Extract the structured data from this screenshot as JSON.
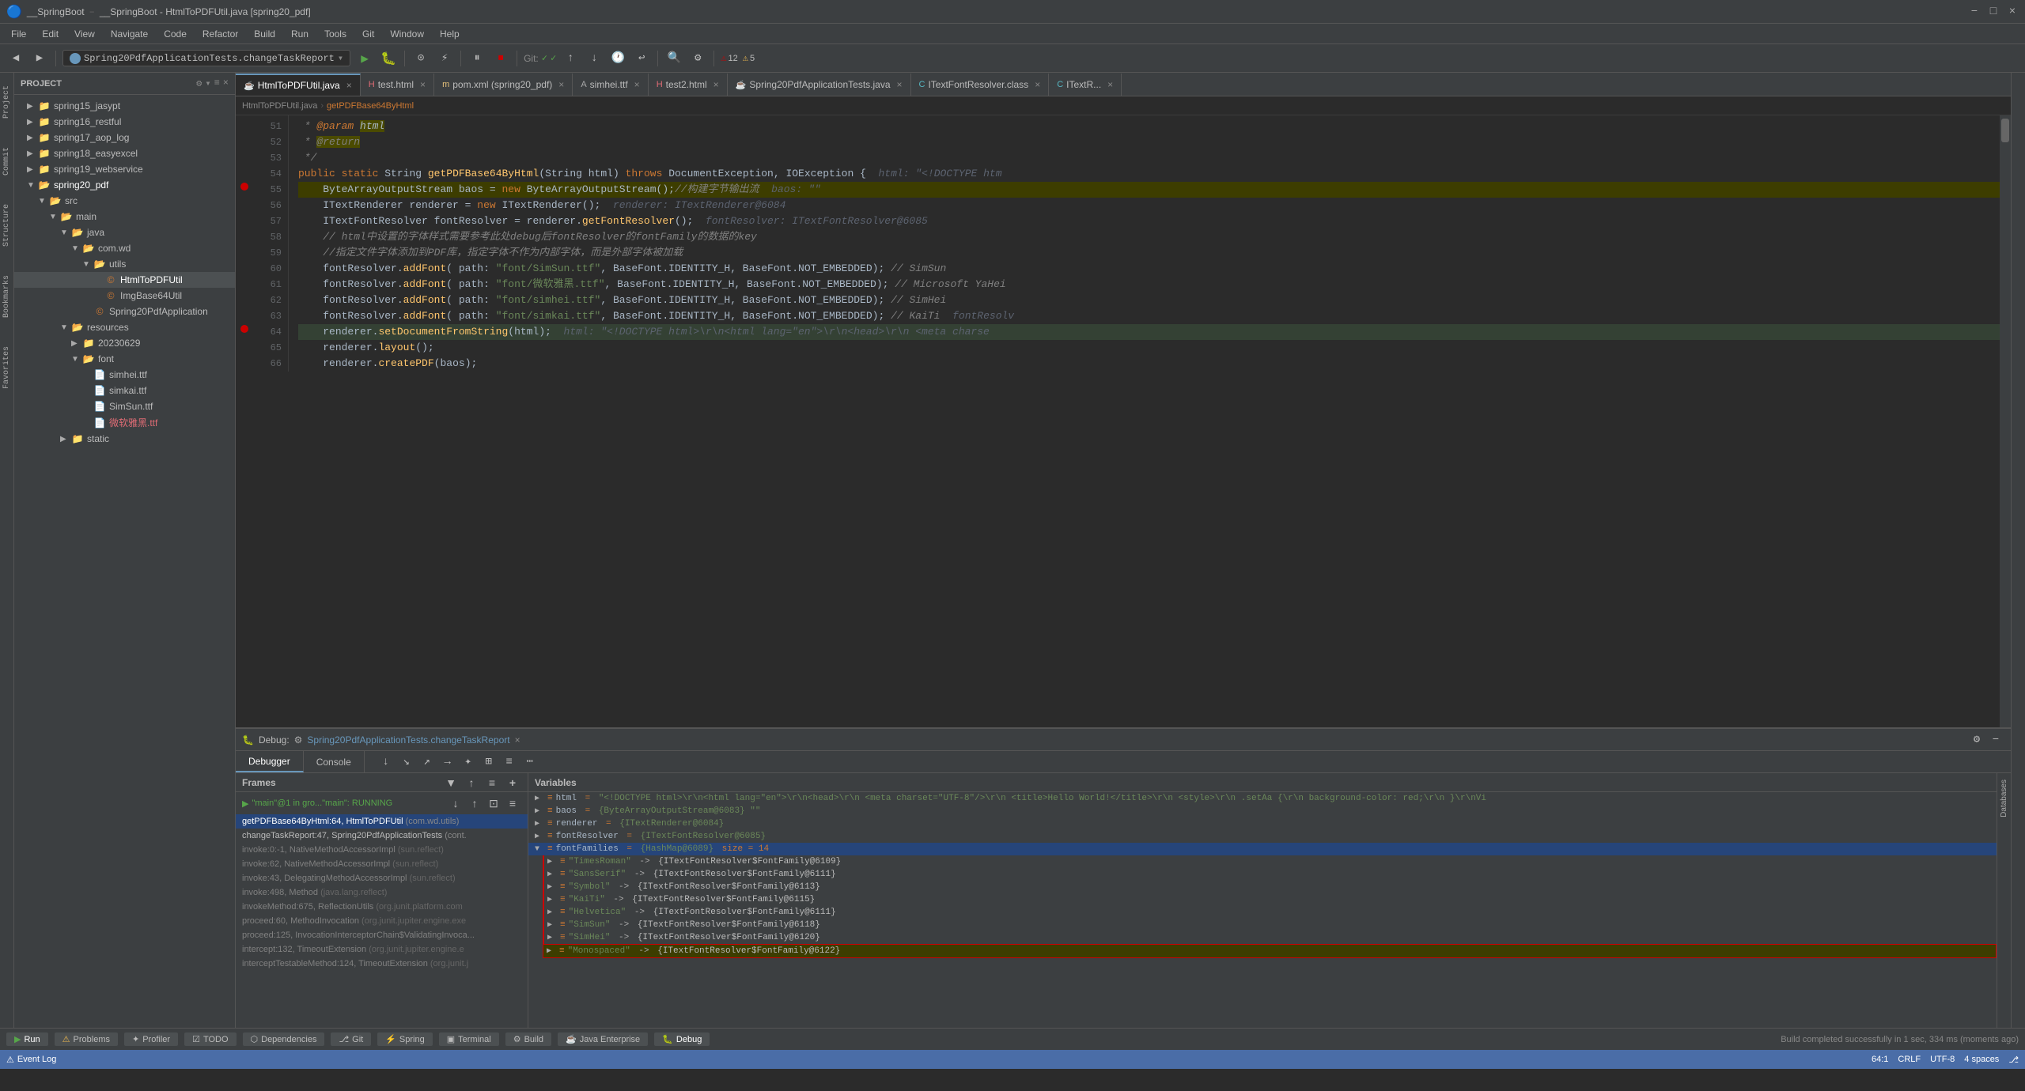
{
  "titleBar": {
    "title": "__SpringBoot - HtmlToPDFUtil.java [spring20_pdf]",
    "windowControls": [
      "−",
      "□",
      "×"
    ]
  },
  "menuBar": {
    "items": [
      "File",
      "Edit",
      "View",
      "Navigate",
      "Code",
      "Refactor",
      "Build",
      "Run",
      "Tools",
      "Git",
      "Window",
      "Help"
    ]
  },
  "navBar": {
    "items": [
      "SpringBoot",
      "spring20_pdf",
      "src",
      "main",
      "java",
      "com",
      "wd",
      "utils",
      "HtmlToPDFUtil"
    ]
  },
  "runConfig": {
    "label": "Spring20PdfApplicationTests.changeTaskReport",
    "icon": "run-config-icon"
  },
  "toolbar": {
    "gitStatus": "Git:",
    "errorCount": "12",
    "warningCount": "5"
  },
  "tabs": [
    {
      "label": "HtmlToPDFUtil.java",
      "active": true,
      "icon": "java"
    },
    {
      "label": "test.html",
      "active": false,
      "icon": "html"
    },
    {
      "label": "pom.xml (spring20_pdf)",
      "active": false,
      "icon": "xml"
    },
    {
      "label": "simhei.ttf",
      "active": false,
      "icon": "font"
    },
    {
      "label": "test2.html",
      "active": false,
      "icon": "html"
    },
    {
      "label": "Spring20PdfApplicationTests.java",
      "active": false,
      "icon": "java"
    },
    {
      "label": "ITextFontResolver.class",
      "active": false,
      "icon": "class"
    },
    {
      "label": "ITextR...",
      "active": false,
      "icon": "class"
    }
  ],
  "breadcrumb": {
    "items": [
      "HtmlToPDFUtil.java",
      "getPDFBase64ByHtml"
    ]
  },
  "codeLines": [
    {
      "num": 51,
      "content": " * @param html",
      "type": "comment",
      "breakpoint": false
    },
    {
      "num": 52,
      "content": " * @return",
      "type": "comment-ret",
      "breakpoint": false
    },
    {
      "num": 53,
      "content": " */",
      "type": "comment",
      "breakpoint": false
    },
    {
      "num": 54,
      "content": "public static String getPDFBase64ByHtml(String html) throws DocumentException, IOException {  html: \"<!DOCTYPE htm",
      "type": "code",
      "breakpoint": false
    },
    {
      "num": 55,
      "content": "    ByteArrayOutputStream baos = new ByteArrayOutputStream();//构建字节输出流  baos: \"\"",
      "type": "code",
      "breakpoint": true
    },
    {
      "num": 56,
      "content": "    ITextRenderer renderer = new ITextRenderer();  renderer: ITextRenderer@6084",
      "type": "code",
      "breakpoint": false
    },
    {
      "num": 57,
      "content": "    ITextFontResolver fontResolver = renderer.getFontResolver();  fontResolver: ITextFontResolver@6085",
      "type": "code",
      "breakpoint": false
    },
    {
      "num": 58,
      "content": "    // html中设置的字体样式需要参考此处debug后fontResolver的fontFamily的数据的key",
      "type": "comment",
      "breakpoint": false
    },
    {
      "num": 59,
      "content": "    //指定文件字体添加到PDF库，指定字体不作为内部字体，而是外部字体被加载",
      "type": "comment",
      "breakpoint": false
    },
    {
      "num": 60,
      "content": "    fontResolver.addFont( path: \"font/SimSun.ttf\", BaseFont.IDENTITY_H, BaseFont.NOT_EMBEDDED); // SimSun",
      "type": "code",
      "breakpoint": false
    },
    {
      "num": 61,
      "content": "    fontResolver.addFont( path: \"font/微软雅黑.ttf\", BaseFont.IDENTITY_H, BaseFont.NOT_EMBEDDED); // Microsoft YaHei",
      "type": "code",
      "breakpoint": false
    },
    {
      "num": 62,
      "content": "    fontResolver.addFont( path: \"font/simhei.ttf\", BaseFont.IDENTITY_H, BaseFont.NOT_EMBEDDED); // SimHei",
      "type": "code",
      "breakpoint": false
    },
    {
      "num": 63,
      "content": "    fontResolver.addFont( path: \"font/simkai.ttf\", BaseFont.IDENTITY_H, BaseFont.NOT_EMBEDDED); // KaiTi  fontResolv",
      "type": "code",
      "breakpoint": false
    },
    {
      "num": 64,
      "content": "    renderer.setDocumentFromString(html);  html: \"<!DOCTYPE html>\\r\\n<html lang=\\\"en\\\">\\r\\n<head>\\r\\n  <meta charse",
      "type": "code",
      "breakpoint": true,
      "highlighted": true
    },
    {
      "num": 65,
      "content": "    renderer.layout();",
      "type": "code",
      "breakpoint": false
    },
    {
      "num": 66,
      "content": "    renderer.createPDF(baos);",
      "type": "code",
      "breakpoint": false
    }
  ],
  "debugPanel": {
    "title": "Debug:",
    "sessionName": "Spring20PdfApplicationTests.changeTaskReport",
    "tabs": [
      "Debugger",
      "Console"
    ],
    "frames": {
      "header": "Frames",
      "items": [
        {
          "label": "\"main\"@1 in gro...\"main\": RUNNING",
          "active": true,
          "status": "running"
        },
        {
          "label": "getPDFBase64ByHtml:64, HtmlToPDFUtil (com.wd.utils)",
          "selected": true
        },
        {
          "label": "changeTaskReport:47, Spring20PdfApplicationTests (cont.",
          "selected": false
        },
        {
          "label": "invoke:0:-1, NativeMethodAccessorImpl (sun.reflect)",
          "selected": false
        },
        {
          "label": "invoke:62, NativeMethodAccessorImpl (sun.reflect)",
          "selected": false
        },
        {
          "label": "invoke:43, DelegatingMethodAccessorImpl (sun.reflect)",
          "selected": false
        },
        {
          "label": "invoke:498, Method (java.lang.reflect)",
          "selected": false
        },
        {
          "label": "invokeMethod:675, ReflectionUtils (org.junit.platform.com",
          "selected": false
        },
        {
          "label": "proceed:60, MethodInvocation (org.junit.jupiter.engine.exe",
          "selected": false
        },
        {
          "label": "proceed:125, InvocationInterceptorChain$ValidatingInvoca...",
          "selected": false
        },
        {
          "label": "intercept:132, TimeoutExtension (org.junit.jupiter.engine.e",
          "selected": false
        },
        {
          "label": "interceptTestableMethod:124, TimeoutExtension (org.junit.j",
          "selected": false
        }
      ]
    },
    "variables": {
      "header": "Variables",
      "items": [
        {
          "name": "html",
          "eq": "=",
          "val": "\"<!DOCTYPE html>\\r\\n<html lang=\\\"en\\\">\\r\\n<head>\\r\\n  <meta charset=\\\"UTF-8\\\"/>\\r\\n  <title>Hello World!</title>\\r\\n  <style>\\r\\n  .setAa {\\r\\n  background-color: red;\\r\\n  }\\r\\nVi",
          "expanded": false,
          "level": 0
        },
        {
          "name": "baos",
          "eq": "=",
          "val": "{ByteArrayOutputStream@6083} \"\"",
          "expanded": false,
          "level": 0
        },
        {
          "name": "renderer",
          "eq": "=",
          "val": "{ITextRenderer@6084}",
          "expanded": false,
          "level": 0
        },
        {
          "name": "fontResolver",
          "eq": "=",
          "val": "{ITextFontResolver@6085}",
          "expanded": false,
          "level": 0
        },
        {
          "name": "fontFamilies",
          "eq": "=",
          "val": "{HashMap@6089}",
          "size": "size = 14",
          "expanded": true,
          "level": 0,
          "selected": true
        },
        {
          "name": "\"TimesRoman\"",
          "eq": "->",
          "val": "{ITextFontResolver$FontFamily@6109}",
          "expanded": false,
          "level": 1
        },
        {
          "name": "\"SansSerif\"",
          "eq": "->",
          "val": "{ITextFontResolver$FontFamily@6111}",
          "expanded": false,
          "level": 1
        },
        {
          "name": "\"Symbol\"",
          "eq": "->",
          "val": "{ITextFontResolver$FontFamily@6113}",
          "expanded": false,
          "level": 1
        },
        {
          "name": "\"KaiTi\"",
          "eq": "->",
          "val": "{ITextFontResolver$FontFamily@6115}",
          "expanded": false,
          "level": 1
        },
        {
          "name": "\"Helvetica\"",
          "eq": "->",
          "val": "{ITextFontResolver$FontFamily@6111}",
          "expanded": false,
          "level": 1
        },
        {
          "name": "\"SimSun\"",
          "eq": "->",
          "val": "{ITextFontResolver$FontFamily@6118}",
          "expanded": false,
          "level": 1
        },
        {
          "name": "\"SimHei\"",
          "eq": "->",
          "val": "{ITextFontResolver$FontFamily@6120}",
          "expanded": false,
          "level": 1
        },
        {
          "name": "\"Monospaced\"",
          "eq": "->",
          "val": "{ITextFontResolver$FontFamily@6122}",
          "expanded": false,
          "level": 1,
          "highlighted": true
        }
      ]
    }
  },
  "sidebarTree": {
    "header": "Project",
    "items": [
      {
        "label": "spring15_jasypt",
        "icon": "folder",
        "indent": 1
      },
      {
        "label": "spring16_restful",
        "icon": "folder",
        "indent": 1
      },
      {
        "label": "spring17_aop_log",
        "icon": "folder",
        "indent": 1
      },
      {
        "label": "spring18_easyexcel",
        "icon": "folder",
        "indent": 1
      },
      {
        "label": "spring19_webservice",
        "icon": "folder",
        "indent": 1
      },
      {
        "label": "spring20_pdf",
        "icon": "folder-open",
        "indent": 1,
        "highlight": true
      },
      {
        "label": "src",
        "icon": "folder-open",
        "indent": 2
      },
      {
        "label": "main",
        "icon": "folder-open",
        "indent": 3
      },
      {
        "label": "java",
        "icon": "folder-open",
        "indent": 4
      },
      {
        "label": "com.wd",
        "icon": "folder-open",
        "indent": 5
      },
      {
        "label": "utils",
        "icon": "folder-open",
        "indent": 6
      },
      {
        "label": "HtmlToPDFUtil",
        "icon": "class",
        "indent": 7,
        "highlight": true
      },
      {
        "label": "ImgBase64Util",
        "icon": "class",
        "indent": 7
      },
      {
        "label": "Spring20PdfApplication",
        "icon": "class",
        "indent": 6
      },
      {
        "label": "resources",
        "icon": "folder-open",
        "indent": 4
      },
      {
        "label": "20230629",
        "icon": "folder",
        "indent": 5
      },
      {
        "label": "font",
        "icon": "folder-open",
        "indent": 5
      },
      {
        "label": "simhei.ttf",
        "icon": "file",
        "indent": 6
      },
      {
        "label": "simkai.ttf",
        "icon": "file",
        "indent": 6
      },
      {
        "label": "SimSun.ttf",
        "icon": "file",
        "indent": 6
      },
      {
        "label": "微软雅黑.ttf",
        "icon": "file",
        "indent": 6,
        "highlight": true
      },
      {
        "label": "static",
        "icon": "folder",
        "indent": 4
      }
    ]
  },
  "statusBar": {
    "left": [
      "▶ Run",
      "⚠ Problems",
      "✦ Profiler",
      "☑ TODO",
      "⬡ Dependencies",
      "⎇ Git",
      "⚡ Spring",
      "▣ Terminal",
      "⚙ Build",
      "☕ Java Enterprise",
      "⬛ Debug"
    ],
    "right": [
      "64:1",
      "CRLF",
      "UTF-8",
      "4 spaces",
      "⚠ Event Log",
      "Build completed successfully in 1 sec, 334 ms (moments ago)"
    ]
  }
}
